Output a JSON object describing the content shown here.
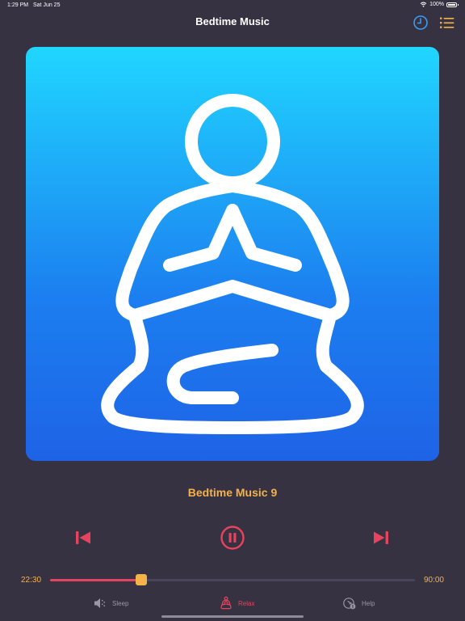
{
  "status_bar": {
    "time": "1:29 PM",
    "date": "Sat Jun 25",
    "battery": "100%",
    "battery_level": 1.0
  },
  "nav": {
    "title": "Bedtime Music",
    "icons": [
      "clock-icon",
      "list-icon"
    ],
    "accent_color": "#3b9cf2",
    "list_color": "#f5b24a"
  },
  "player": {
    "artwork_icon": "meditation-figure-icon",
    "track_title": "Bedtime Music 9",
    "elapsed": "22:30",
    "total": "90:00",
    "progress_fraction": 0.25,
    "controls": [
      "previous-icon",
      "pause-icon",
      "next-icon"
    ]
  },
  "tabs": [
    {
      "label": "Sleep",
      "icon": "speaker-icon",
      "active": false
    },
    {
      "label": "Relax",
      "icon": "meditation-icon",
      "active": true
    },
    {
      "label": "Help",
      "icon": "help-icon",
      "active": false
    }
  ],
  "colors": {
    "background": "#363241",
    "accent_red": "#e8435e",
    "accent_orange": "#f5b24a",
    "artwork_top": "#20d6ff",
    "artwork_bottom": "#1e63e6"
  }
}
